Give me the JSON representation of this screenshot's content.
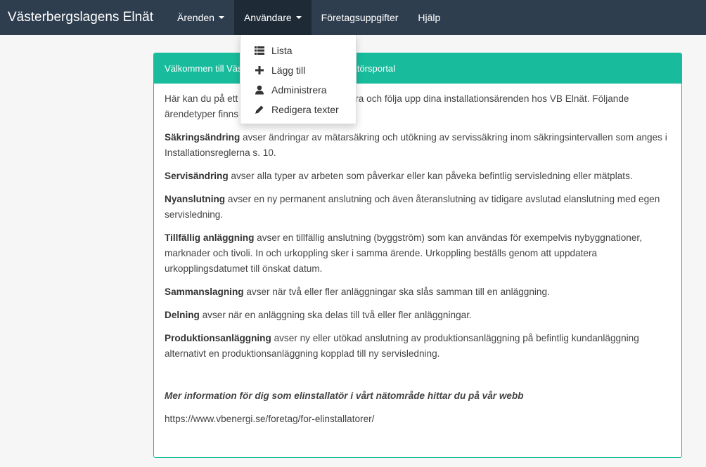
{
  "navbar": {
    "brand": "Västerbergslagens Elnät",
    "items": [
      {
        "label": "Ärenden",
        "dropdown": true
      },
      {
        "label": "Användare",
        "dropdown": true,
        "active": true
      },
      {
        "label": "Företagsuppgifter"
      },
      {
        "label": "Hjälp"
      }
    ]
  },
  "dropdown": {
    "items": [
      {
        "label": "Lista",
        "icon": "list-icon"
      },
      {
        "label": "Lägg till",
        "icon": "plus-icon"
      },
      {
        "label": "Administrera",
        "icon": "user-icon"
      },
      {
        "label": "Redigera texter",
        "icon": "pencil-icon"
      }
    ]
  },
  "panel": {
    "heading": "Välkommen till Västerbergslagens Elnät installatörsportal",
    "intro": "Här kan du på ett enkelt sätt anmäla, registrera och följa upp dina installationsärenden hos VB Elnät. Följande ärendetyper finns i installatörsportalen:",
    "sections": [
      {
        "term": "Säkringsändring",
        "text": " avser ändringar av mätarsäkring och utökning av servissäkring inom säkringsintervallen som anges i Installationsreglerna s. 10."
      },
      {
        "term": "Servisändring",
        "text": " avser alla typer av arbeten som påverkar eller kan påveka befintlig servisledning eller mätplats."
      },
      {
        "term": "Nyanslutning",
        "text": " avser en ny permanent anslutning och även återanslutning av tidigare avslutad elanslutning med egen servisledning."
      },
      {
        "term": "Tillfällig anläggning",
        "text": " avser en tillfällig anslutning (byggström) som kan användas för exempelvis nybyggnationer, marknader och tivoli. In och urkoppling sker i samma ärende. Urkoppling beställs genom att uppdatera urkopplingsdatumet till önskat datum."
      },
      {
        "term": "Sammanslagning",
        "text": " avser när två eller fler anläggningar ska slås samman till en anläggning."
      },
      {
        "term": "Delning",
        "text": " avser när en anläggning ska delas till två eller fler anläggningar."
      },
      {
        "term": "Produktionsanläggning",
        "text": " avser ny eller utökad anslutning av produktionsanläggning på befintlig kundanläggning alternativt en produktionsanläggning kopplad till ny servisledning."
      }
    ],
    "more_info": "Mer information för dig som elinstallatör i vårt nätområde hittar du på vår webb",
    "link": "https://www.vbenergi.se/foretag/for-elinstallatorer/"
  },
  "colors": {
    "navbar": "#2f3e4f",
    "navbar_active": "#1e2a36",
    "accent": "#18bc9c"
  }
}
